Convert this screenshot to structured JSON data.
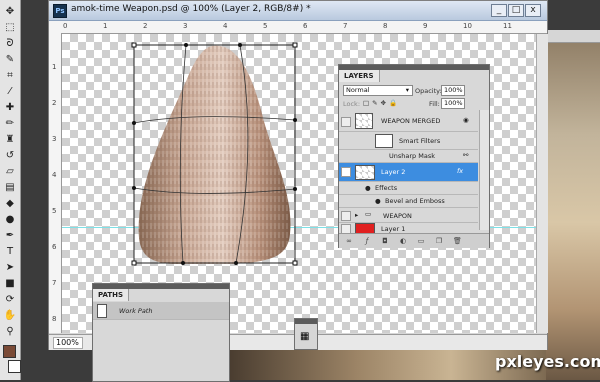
{
  "document": {
    "title": "amok-time Weapon.psd @ 100% (Layer 2, RGB/8#) *",
    "app_icon": "Ps",
    "zoom": "100%",
    "ruler_top_ticks": [
      "0",
      "1",
      "2",
      "3",
      "4",
      "5",
      "6",
      "7",
      "8",
      "9",
      "10",
      "11"
    ],
    "ruler_left_ticks": [
      "1",
      "2",
      "3",
      "4",
      "5",
      "6",
      "7",
      "8"
    ]
  },
  "window_buttons": {
    "minimize": "_",
    "maximize": "□",
    "close": "x"
  },
  "layers_panel": {
    "tab": "LAYERS",
    "blend_mode": "Normal",
    "opacity_label": "Opacity:",
    "opacity_value": "100%",
    "lock_label": "Lock:",
    "fill_label": "Fill:",
    "fill_value": "100%",
    "rows": [
      {
        "name": "WEAPON MERGED"
      },
      {
        "name": "Smart Filters"
      },
      {
        "name": "Unsharp Mask"
      },
      {
        "name": "Layer 2"
      },
      {
        "name": "Effects"
      },
      {
        "name": "Bevel and Emboss"
      },
      {
        "name": "WEAPON"
      },
      {
        "name": "Layer 1"
      }
    ],
    "fx": "fx"
  },
  "paths_panel": {
    "tab": "PATHS",
    "items": [
      {
        "name": "Work Path"
      }
    ]
  },
  "watermark": "pxleyes.com",
  "colors": {
    "selected_row": "#3d8de0",
    "foreground_swatch": "#7a4a36",
    "background_swatch": "#ffffff",
    "layer1_thumb": "#e02020"
  },
  "tools": [
    "move-icon",
    "marquee-icon",
    "lasso-icon",
    "quick-select-icon",
    "crop-icon",
    "eyedropper-icon",
    "healing-icon",
    "brush-icon",
    "clone-stamp-icon",
    "history-brush-icon",
    "eraser-icon",
    "gradient-icon",
    "blur-icon",
    "dodge-icon",
    "pen-icon",
    "type-icon",
    "path-select-icon",
    "shape-icon",
    "3d-rotate-icon",
    "3d-orbit-icon",
    "hand-icon",
    "zoom-icon"
  ]
}
